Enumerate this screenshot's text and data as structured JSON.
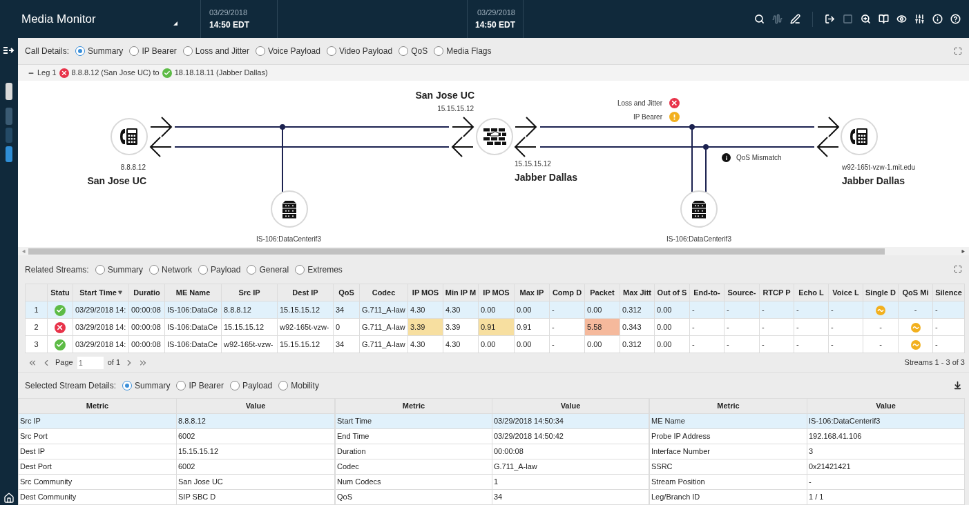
{
  "header": {
    "title": "Media Monitor",
    "time_range": [
      {
        "date": "03/29/2018",
        "time": "14:50 EDT"
      },
      {
        "date": "03/29/2018",
        "time": "14:50 EDT"
      }
    ]
  },
  "call_details": {
    "label": "Call Details:",
    "options": [
      {
        "label": "Summary",
        "selected": true
      },
      {
        "label": "IP Bearer",
        "selected": false
      },
      {
        "label": "Loss and Jitter",
        "selected": false
      },
      {
        "label": "Voice Payload",
        "selected": false
      },
      {
        "label": "Video Payload",
        "selected": false
      },
      {
        "label": "QoS",
        "selected": false
      },
      {
        "label": "Media Flags",
        "selected": false
      }
    ]
  },
  "leg": {
    "label": "Leg 1",
    "from_ok": false,
    "from": "8.8.8.12 (San Jose UC) to",
    "to_ok": true,
    "to": "18.18.18.11 (Jabber Dallas)"
  },
  "diagram": {
    "nodes": [
      {
        "kind": "phone"
      },
      {
        "kind": "server"
      },
      {
        "kind": "sbc"
      },
      {
        "kind": "server"
      },
      {
        "kind": "phone"
      }
    ],
    "labels": [
      {
        "kind": "name",
        "text": "San Jose UC"
      },
      {
        "kind": "address",
        "text": "15.15.15.12"
      },
      {
        "kind": "address",
        "text": "8.8.8.12"
      },
      {
        "kind": "name",
        "text": "San Jose UC"
      },
      {
        "kind": "address",
        "text": "IS-106:DataCenterif3"
      },
      {
        "kind": "address",
        "text": "15.15.15.12"
      },
      {
        "kind": "name",
        "text": "Jabber Dallas"
      },
      {
        "kind": "address",
        "text": "IS-106:DataCenterif3"
      },
      {
        "kind": "address",
        "text": "w92-165t-vzw-1.mit.edu"
      },
      {
        "kind": "name",
        "text": "Jabber Dallas"
      }
    ],
    "alerts": [
      {
        "text": "Loss and Jitter",
        "kind": "error"
      },
      {
        "text": "IP Bearer",
        "kind": "warning"
      },
      {
        "text": "QoS Mismatch",
        "kind": "info"
      }
    ]
  },
  "related_streams": {
    "label": "Related Streams:",
    "options": [
      {
        "label": "Summary",
        "selected": false
      },
      {
        "label": "Network",
        "selected": false
      },
      {
        "label": "Payload",
        "selected": false
      },
      {
        "label": "General",
        "selected": false
      },
      {
        "label": "Extremes",
        "selected": false
      }
    ],
    "columns": [
      "",
      "Statu",
      "Start Time",
      "Duratio",
      "ME Name",
      "Src IP",
      "Dest IP",
      "QoS",
      "Codec",
      "IP MOS",
      "Min IP M",
      "IP MOS",
      "Max IP",
      "Comp D",
      "Packet",
      "Max Jitt",
      "Out of S",
      "End-to-",
      "Source-",
      "RTCP P",
      "Echo L",
      "Voice L",
      "Single D",
      "QoS Mi",
      "Silence"
    ],
    "rows": [
      {
        "selected": true,
        "cells": [
          {
            "text": "1"
          },
          {
            "kind": "ok"
          },
          {
            "text": "03/29/2018 14:"
          },
          {
            "text": "00:00:08"
          },
          {
            "text": "IS-106:DataCe"
          },
          {
            "text": "8.8.8.12"
          },
          {
            "text": "15.15.15.12"
          },
          {
            "text": "34"
          },
          {
            "text": "G.711_A-law"
          },
          {
            "text": "4.30"
          },
          {
            "text": "4.30"
          },
          {
            "text": "0.00"
          },
          {
            "text": "0.00"
          },
          {
            "text": "-"
          },
          {
            "text": "0.00"
          },
          {
            "text": "0.312"
          },
          {
            "text": "0.00"
          },
          {
            "text": "-"
          },
          {
            "text": "-"
          },
          {
            "text": "-"
          },
          {
            "text": "-"
          },
          {
            "text": "-"
          },
          {
            "kind": "icon"
          },
          {
            "text": "-"
          },
          {
            "text": "-"
          }
        ]
      },
      {
        "selected": false,
        "cells": [
          {
            "text": "2"
          },
          {
            "kind": "error"
          },
          {
            "text": "03/29/2018 14:"
          },
          {
            "text": "00:00:08"
          },
          {
            "text": "IS-106:DataCe"
          },
          {
            "text": "15.15.15.12"
          },
          {
            "text": "w92-165t-vzw-"
          },
          {
            "text": "0"
          },
          {
            "text": "G.711_A-law"
          },
          {
            "text": "3.39",
            "color": "#f7dfa0"
          },
          {
            "text": "3.39"
          },
          {
            "text": "0.91",
            "color": "#f7dfa0"
          },
          {
            "text": "0.91"
          },
          {
            "text": "-"
          },
          {
            "text": "5.58",
            "color": "#f5b99c"
          },
          {
            "text": "0.343"
          },
          {
            "text": "0.00"
          },
          {
            "text": "-"
          },
          {
            "text": "-"
          },
          {
            "text": "-"
          },
          {
            "text": "-"
          },
          {
            "text": "-"
          },
          {
            "text": "-"
          },
          {
            "kind": "icon"
          },
          {
            "text": "-"
          }
        ]
      },
      {
        "selected": false,
        "cells": [
          {
            "text": "3"
          },
          {
            "kind": "ok"
          },
          {
            "text": "03/29/2018 14:"
          },
          {
            "text": "00:00:08"
          },
          {
            "text": "IS-106:DataCe"
          },
          {
            "text": "w92-165t-vzw-"
          },
          {
            "text": "15.15.15.12"
          },
          {
            "text": "34"
          },
          {
            "text": "G.711_A-law"
          },
          {
            "text": "4.30"
          },
          {
            "text": "4.30"
          },
          {
            "text": "0.00"
          },
          {
            "text": "0.00"
          },
          {
            "text": "-"
          },
          {
            "text": "0.00"
          },
          {
            "text": "0.312"
          },
          {
            "text": "0.00"
          },
          {
            "text": "-"
          },
          {
            "text": "-"
          },
          {
            "text": "-"
          },
          {
            "text": "-"
          },
          {
            "text": "-"
          },
          {
            "text": "-"
          },
          {
            "kind": "icon"
          },
          {
            "text": "-"
          }
        ]
      }
    ],
    "pager": {
      "page_label": "Page",
      "page": "1",
      "of": "of 1",
      "summary": "Streams 1 - 3 of 3"
    }
  },
  "stream_details": {
    "label": "Selected Stream Details:",
    "options": [
      {
        "label": "Summary",
        "selected": true
      },
      {
        "label": "IP Bearer",
        "selected": false
      },
      {
        "label": "Payload",
        "selected": false
      },
      {
        "label": "Mobility",
        "selected": false
      }
    ],
    "tables": [
      {
        "columns": [
          "Metric",
          "Value"
        ],
        "rows": [
          {
            "metric": "Src IP",
            "value": "8.8.8.12",
            "selected": true
          },
          {
            "metric": "Src Port",
            "value": "6002",
            "selected": false
          },
          {
            "metric": "Dest IP",
            "value": "15.15.15.12",
            "selected": false
          },
          {
            "metric": "Dest Port",
            "value": "6002",
            "selected": false
          },
          {
            "metric": "Src Community",
            "value": "San Jose UC",
            "selected": false
          },
          {
            "metric": "Dest Community",
            "value": "SIP SBC D",
            "selected": false
          }
        ]
      },
      {
        "columns": [
          "Metric",
          "Value"
        ],
        "rows": [
          {
            "metric": "Start Time",
            "value": "03/29/2018 14:50:34",
            "selected": true
          },
          {
            "metric": "End Time",
            "value": "03/29/2018 14:50:42",
            "selected": false
          },
          {
            "metric": "Duration",
            "value": "00:00:08",
            "selected": false
          },
          {
            "metric": "Codec",
            "value": "G.711_A-law",
            "selected": false
          },
          {
            "metric": "Num Codecs",
            "value": "1",
            "selected": false
          },
          {
            "metric": "QoS",
            "value": "34",
            "selected": false
          }
        ]
      },
      {
        "columns": [
          "Metric",
          "Value"
        ],
        "rows": [
          {
            "metric": "ME Name",
            "value": "IS-106:DataCenterif3",
            "selected": true
          },
          {
            "metric": "Probe IP Address",
            "value": "192.168.41.106",
            "selected": false
          },
          {
            "metric": "Interface Number",
            "value": "3",
            "selected": false
          },
          {
            "metric": "SSRC",
            "value": "0x21421421",
            "selected": false
          },
          {
            "metric": "Stream Position",
            "value": "-",
            "selected": false
          },
          {
            "metric": "Leg/Branch ID",
            "value": "1 / 1",
            "selected": false
          }
        ]
      }
    ]
  }
}
